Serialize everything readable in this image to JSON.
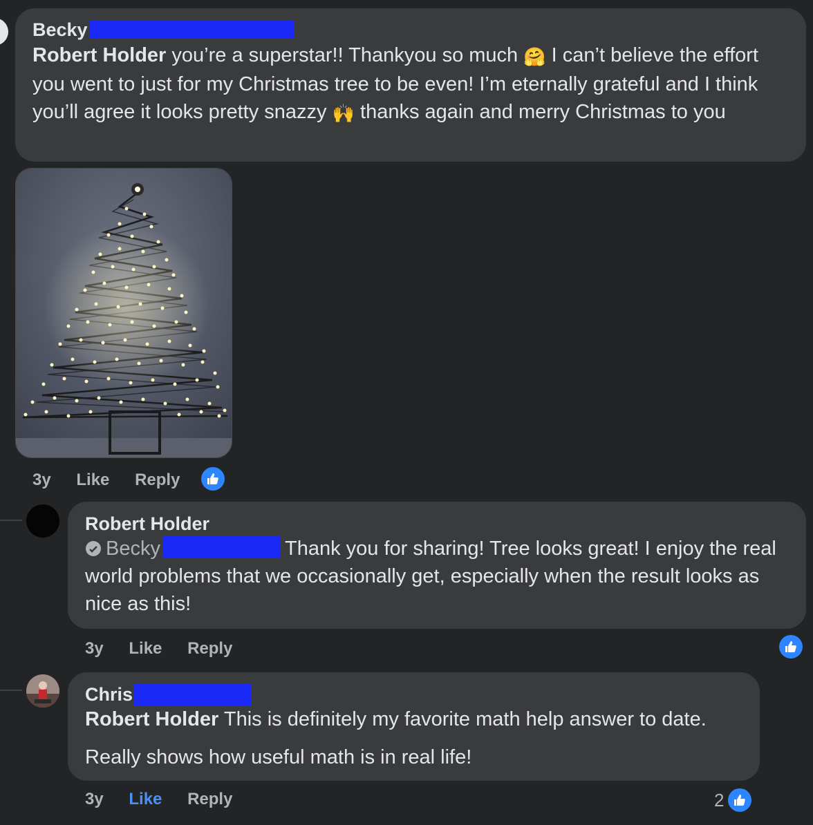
{
  "comments": [
    {
      "author": "Becky",
      "mention": "Robert Holder",
      "text_part1": " you’re a superstar!! Thankyou so much ",
      "emoji1": "🤗",
      "text_part2": " I can’t believe the effort you went to just for my Christmas tree to be even! I’m eternally grateful and I think you’ll agree it looks pretty snazzy ",
      "emoji2": "🙌",
      "text_part3": " thanks again and merry Christmas to you",
      "time": "3y",
      "like_label": "Like",
      "reply_label": "Reply"
    },
    {
      "author": "Robert Holder",
      "mention": "Becky",
      "text": "Thank you for sharing! Tree looks great! I enjoy the real world problems that we occasionally get, especially when the result looks as nice as this!",
      "time": "3y",
      "like_label": "Like",
      "reply_label": "Reply"
    },
    {
      "author": "Chris",
      "mention": "Robert Holder",
      "text_line1": " This is definitely my favorite math help answer to date.",
      "text_line2": "Really shows how useful math is in real life!",
      "time": "3y",
      "like_label": "Like",
      "reply_label": "Reply",
      "reaction_count": "2"
    }
  ],
  "colors": {
    "background": "#232426",
    "bubble": "#3a3b3c",
    "redaction": "#1a28f5",
    "like_blue": "#2d86ff"
  }
}
